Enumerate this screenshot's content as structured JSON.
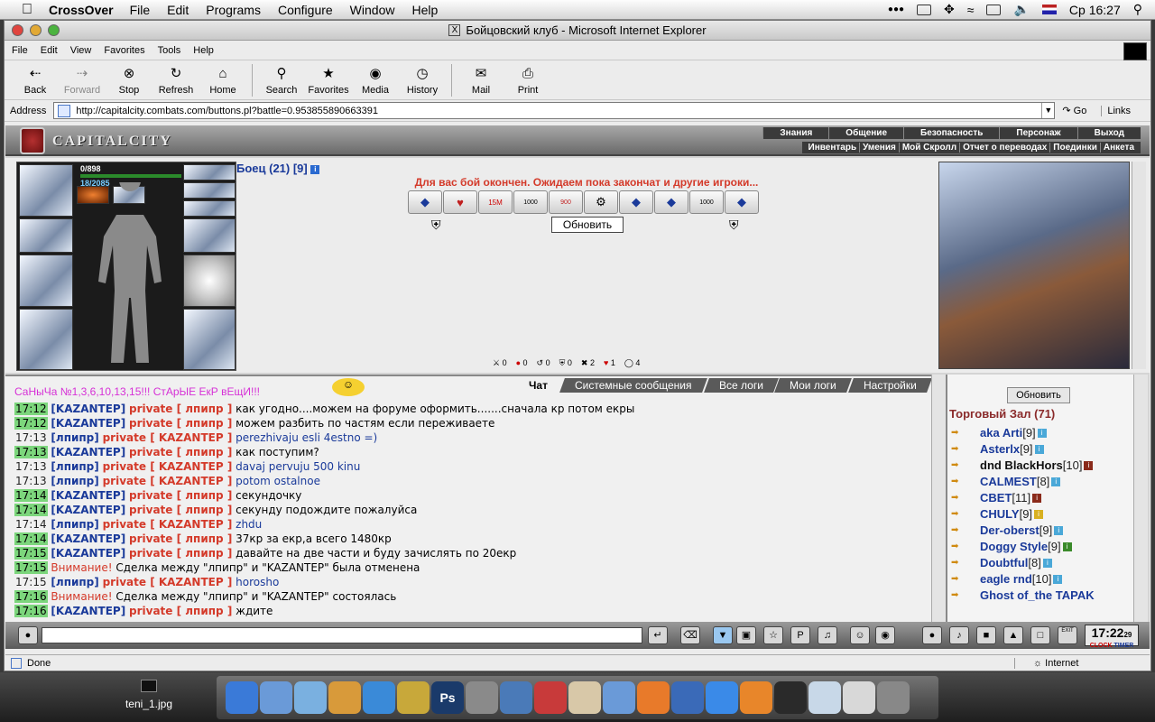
{
  "menubar": {
    "app_name": "CrossOver",
    "items": [
      "File",
      "Edit",
      "Programs",
      "Configure",
      "Window",
      "Help"
    ],
    "clock": "Ср 16:27"
  },
  "window": {
    "title": "Бойцовский клуб - Microsoft Internet Explorer"
  },
  "ie_menu": [
    "File",
    "Edit",
    "View",
    "Favorites",
    "Tools",
    "Help"
  ],
  "toolbar": {
    "back": "Back",
    "forward": "Forward",
    "stop": "Stop",
    "refresh": "Refresh",
    "home": "Home",
    "search": "Search",
    "favorites": "Favorites",
    "media": "Media",
    "history": "History",
    "mail": "Mail",
    "print": "Print"
  },
  "address": {
    "label": "Address",
    "url": "http://capitalcity.combats.com/buttons.pl?battle=0.953855890663391",
    "go": "Go",
    "links": "Links"
  },
  "game": {
    "logo": "CAPITALCITY",
    "nav_top": [
      "Знания",
      "Общение",
      "Безопасность",
      "Персонаж",
      "Выход"
    ],
    "nav_bottom": [
      "Инвентарь",
      "Умения",
      "Мой Скролл",
      "Отчет о переводах",
      "Поединки",
      "Анкета"
    ],
    "hp_line1": "0/898",
    "hp_line2": "18/2085",
    "fighter_name": "Боец (21) [9]",
    "battle_msg": "Для вас бой окончен. Ожидаем пока закончат и другие игроки...",
    "scroll_labels": [
      "",
      "",
      "15M",
      "1000",
      "900",
      "",
      "",
      "",
      "1000",
      ""
    ],
    "refresh_button": "Обновить",
    "counters": [
      "0",
      "0",
      "0",
      "0",
      "2",
      "1",
      "4"
    ]
  },
  "chat": {
    "tabs": [
      "Чат",
      "Системные сообщения",
      "Все логи",
      "Мои логи",
      "Настройки"
    ],
    "sys_line": "СаНыЧа №1,3,6,10,13,15!!! СтАрЫЕ ЕкР вЕщИ!!!",
    "lines": [
      {
        "time": "17:12",
        "hl": true,
        "from": "[KAZANTEP]",
        "to": "private [ лпипр ]",
        "text": "как угодно....можем на форуме оформить.......сначала кр потом екры",
        "blue": false
      },
      {
        "time": "17:12",
        "hl": true,
        "from": "[KAZANTEP]",
        "to": "private [ лпипр ]",
        "text": "можем разбить по частям если переживаете",
        "blue": false
      },
      {
        "time": "17:13",
        "hl": false,
        "from": "[лпипр]",
        "to": "private [ KAZANTEP ]",
        "text": "perezhivaju esli 4estno =)",
        "blue": true
      },
      {
        "time": "17:13",
        "hl": true,
        "from": "[KAZANTEP]",
        "to": "private [ лпипр ]",
        "text": "как поступим?",
        "blue": false
      },
      {
        "time": "17:13",
        "hl": false,
        "from": "[лпипр]",
        "to": "private [ KAZANTEP ]",
        "text": "davaj pervuju 500 kinu",
        "blue": true
      },
      {
        "time": "17:13",
        "hl": false,
        "from": "[лпипр]",
        "to": "private [ KAZANTEP ]",
        "text": "potom ostalnoe",
        "blue": true
      },
      {
        "time": "17:14",
        "hl": true,
        "from": "[KAZANTEP]",
        "to": "private [ лпипр ]",
        "text": "секундочку",
        "blue": false
      },
      {
        "time": "17:14",
        "hl": true,
        "from": "[KAZANTEP]",
        "to": "private [ лпипр ]",
        "text": "секунду подождите пожалуйса",
        "blue": false
      },
      {
        "time": "17:14",
        "hl": false,
        "from": "[лпипр]",
        "to": "private [ KAZANTEP ]",
        "text": "zhdu",
        "blue": true
      },
      {
        "time": "17:14",
        "hl": true,
        "from": "[KAZANTEP]",
        "to": "private [ лпипр ]",
        "text": "37кр за екр,а всего 1480кр",
        "blue": false
      },
      {
        "time": "17:15",
        "hl": true,
        "from": "[KAZANTEP]",
        "to": "private [ лпипр ]",
        "text": "давайте на две части и буду зачислять по 20екр",
        "blue": false
      },
      {
        "time": "17:15",
        "hl": true,
        "warn": "Внимание!",
        "text": "Сделка между \"лпипр\" и \"KAZANTEP\" была отменена"
      },
      {
        "time": "17:15",
        "hl": false,
        "from": "[лпипр]",
        "to": "private [ KAZANTEP ]",
        "text": "horosho",
        "blue": true
      },
      {
        "time": "17:16",
        "hl": true,
        "warn": "Внимание!",
        "text": "Сделка между \"лпипр\" и \"KAZANTEP\" состоялась"
      },
      {
        "time": "17:16",
        "hl": true,
        "from": "[KAZANTEP]",
        "to": "private [ лпипр ]",
        "text": "ждите",
        "blue": false
      }
    ]
  },
  "room": {
    "refresh": "Обновить",
    "title": "Торговый Зал (71)",
    "users": [
      {
        "name": "aka Arti",
        "level": "[9]",
        "badge": "#4aa8d8"
      },
      {
        "name": "Asterlx",
        "level": "[9]",
        "badge": "#4aa8d8"
      },
      {
        "name": "dnd BlackHors",
        "level": "[10]",
        "badge": "#8a2a1a",
        "black_prefix": true
      },
      {
        "name": "CALMEST",
        "level": "[8]",
        "badge": "#4aa8d8"
      },
      {
        "name": "CBET",
        "level": "[11]",
        "badge": "#8a2a1a"
      },
      {
        "name": "CHULY",
        "level": "[9]",
        "badge": "#d8b020"
      },
      {
        "name": "Der-oberst",
        "level": "[9]",
        "badge": "#4aa8d8"
      },
      {
        "name": "Doggy Style",
        "level": "[9]",
        "badge": "#3a8a2a"
      },
      {
        "name": "Doubtful",
        "level": "[8]",
        "badge": "#4aa8d8"
      },
      {
        "name": "eagle rnd",
        "level": "[10]",
        "badge": "#4aa8d8"
      },
      {
        "name": "Ghost of_the TAPAK",
        "level": "",
        "badge": ""
      }
    ]
  },
  "bottombar": {
    "clock": "17:22",
    "clock_sec": "29",
    "clock_label": "CLOCK",
    "timer_label": "TIMER",
    "exit_label": "EXIT"
  },
  "status": {
    "left": "Done",
    "zone": "Internet"
  },
  "desktop": {
    "file_label": "teni_1.jpg"
  },
  "dock": [
    {
      "icon": "finder-icon",
      "color": "#3a7ad8"
    },
    {
      "icon": "safari-icon",
      "color": "#6a9ad8"
    },
    {
      "icon": "itunes-icon",
      "color": "#7ab0e0"
    },
    {
      "icon": "crossover-icon",
      "color": "#d89a3a"
    },
    {
      "icon": "dropbox-icon",
      "color": "#3a8ad8"
    },
    {
      "icon": "star-icon",
      "color": "#c8a83a"
    },
    {
      "icon": "photoshop-icon",
      "color": "#1a3a6a",
      "text": "Ps"
    },
    {
      "icon": "camera-icon",
      "color": "#8a8a8a"
    },
    {
      "icon": "user-icon",
      "color": "#4a7ab8"
    },
    {
      "icon": "pencil-icon",
      "color": "#c83a3a"
    },
    {
      "icon": "preview-icon",
      "color": "#d8c8a8"
    },
    {
      "icon": "folder-icon",
      "color": "#6a9ad8"
    },
    {
      "icon": "firefox-icon",
      "color": "#e87a2a"
    },
    {
      "icon": "thunderbird-icon",
      "color": "#3a6ab8"
    },
    {
      "icon": "ie-icon",
      "color": "#3a8ae8"
    },
    {
      "icon": "vlc-icon",
      "color": "#e8862a"
    },
    {
      "icon": "terminal-icon",
      "color": "#2a2a2a"
    },
    {
      "icon": "window-icon",
      "color": "#c8d8e8"
    },
    {
      "icon": "window2-icon",
      "color": "#d8d8d8"
    },
    {
      "icon": "trash-icon",
      "color": "#888888"
    }
  ]
}
